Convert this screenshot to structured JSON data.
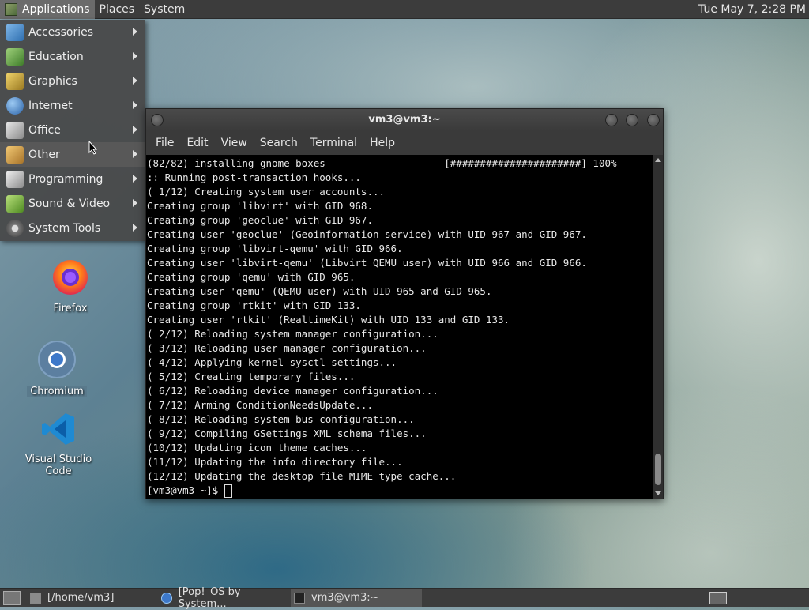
{
  "top_panel": {
    "menus": [
      "Applications",
      "Places",
      "System"
    ],
    "clock": "Tue May 7, 2:28 PM"
  },
  "app_menu": {
    "items": [
      {
        "label": "Accessories",
        "icon": "accessories-icon",
        "color": "#4a8fd1"
      },
      {
        "label": "Education",
        "icon": "education-icon",
        "color": "#6aa84f"
      },
      {
        "label": "Graphics",
        "icon": "graphics-icon",
        "color": "#c9a13b"
      },
      {
        "label": "Internet",
        "icon": "internet-icon",
        "color": "#3b7bc9"
      },
      {
        "label": "Office",
        "icon": "office-icon",
        "color": "#b0b0b0"
      },
      {
        "label": "Other",
        "icon": "other-icon",
        "color": "#d4a74a"
      },
      {
        "label": "Programming",
        "icon": "programming-icon",
        "color": "#c0c0c0"
      },
      {
        "label": "Sound & Video",
        "icon": "sound-video-icon",
        "color": "#7bb34a"
      },
      {
        "label": "System Tools",
        "icon": "system-tools-icon",
        "color": "#9a9a9a"
      }
    ],
    "hovered": "Other"
  },
  "desktop": {
    "icons": [
      {
        "label": "Firefox",
        "icon": "firefox-icon"
      },
      {
        "label": "Chromium",
        "icon": "chromium-icon"
      },
      {
        "label": "Visual Studio Code",
        "icon": "vscode-icon"
      }
    ]
  },
  "terminal": {
    "title": "vm3@vm3:~",
    "menu": [
      "File",
      "Edit",
      "View",
      "Search",
      "Terminal",
      "Help"
    ],
    "lines": [
      "(82/82) installing gnome-boxes                    [######################] 100%",
      ":: Running post-transaction hooks...",
      "( 1/12) Creating system user accounts...",
      "Creating group 'libvirt' with GID 968.",
      "Creating group 'geoclue' with GID 967.",
      "Creating user 'geoclue' (Geoinformation service) with UID 967 and GID 967.",
      "Creating group 'libvirt-qemu' with GID 966.",
      "Creating user 'libvirt-qemu' (Libvirt QEMU user) with UID 966 and GID 966.",
      "Creating group 'qemu' with GID 965.",
      "Creating user 'qemu' (QEMU user) with UID 965 and GID 965.",
      "Creating group 'rtkit' with GID 133.",
      "Creating user 'rtkit' (RealtimeKit) with UID 133 and GID 133.",
      "( 2/12) Reloading system manager configuration...",
      "( 3/12) Reloading user manager configuration...",
      "( 4/12) Applying kernel sysctl settings...",
      "( 5/12) Creating temporary files...",
      "( 6/12) Reloading device manager configuration...",
      "( 7/12) Arming ConditionNeedsUpdate...",
      "( 8/12) Reloading system bus configuration...",
      "( 9/12) Compiling GSettings XML schema files...",
      "(10/12) Updating icon theme caches...",
      "(11/12) Updating the info directory file...",
      "(12/12) Updating the desktop file MIME type cache..."
    ],
    "prompt": "[vm3@vm3 ~]$ "
  },
  "taskbar": {
    "tasks": [
      {
        "label": "[/home/vm3]",
        "icon": "folder-icon"
      },
      {
        "label": "[Pop!_OS by System...",
        "icon": "browser-icon"
      },
      {
        "label": "vm3@vm3:~",
        "icon": "terminal-icon"
      }
    ]
  }
}
